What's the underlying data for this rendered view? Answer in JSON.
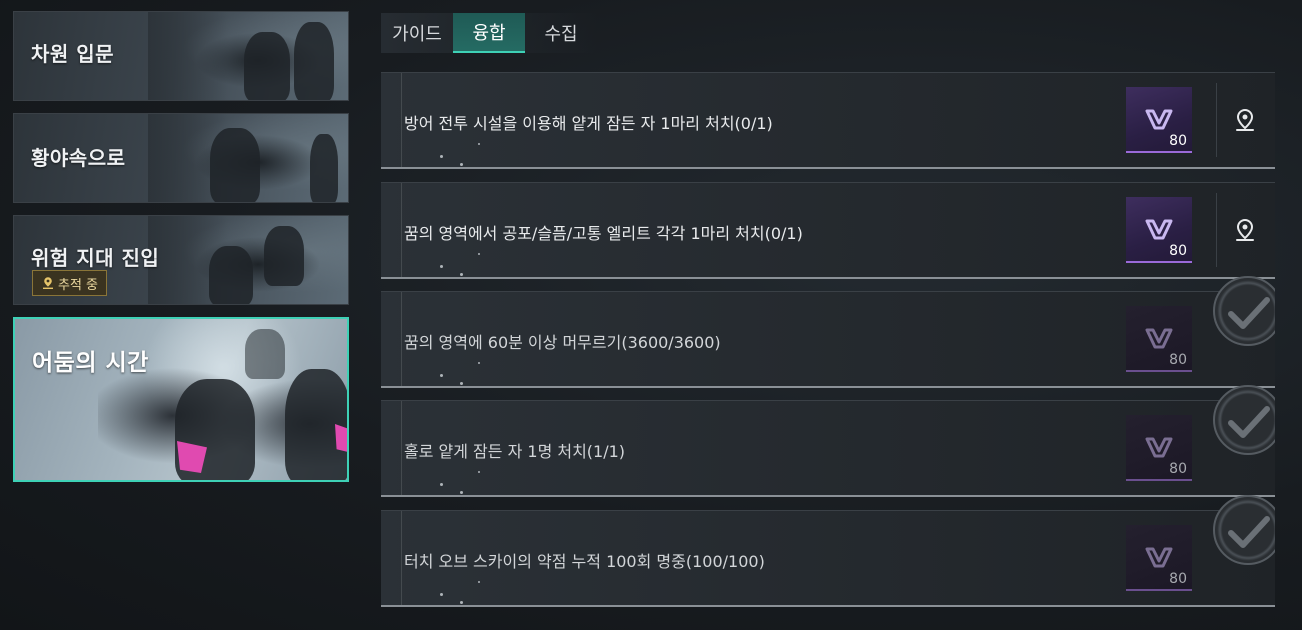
{
  "chapters": [
    {
      "title": "차원 입문"
    },
    {
      "title": "황야속으로"
    },
    {
      "title": "위험 지대 진입",
      "badge": "추적 중"
    },
    {
      "title": "어둠의 시간",
      "selected": true
    }
  ],
  "tabs": [
    {
      "label": "가이드"
    },
    {
      "label": "융합",
      "active": true
    },
    {
      "label": "수집"
    }
  ],
  "missions": [
    {
      "text": "방어 전투 시설을 이용해 얕게 잠든 자 1마리 처치(0/1)",
      "reward_qty": "80",
      "completed": false
    },
    {
      "text": "꿈의 영역에서 공포/슬픔/고통 엘리트 각각 1마리 처치(0/1)",
      "reward_qty": "80",
      "completed": false
    },
    {
      "text": "꿈의 영역에 60분 이상 머무르기(3600/3600)",
      "reward_qty": "80",
      "completed": true
    },
    {
      "text": "홀로 얕게 잠든 자 1명 처치(1/1)",
      "reward_qty": "80",
      "completed": true
    },
    {
      "text": "터치 오브 스카이의 약점 누적 100회 명중(100/100)",
      "reward_qty": "80",
      "completed": true
    }
  ],
  "icons": {
    "reward": "reward-crystal-icon",
    "locate": "map-pin-icon",
    "completed": "checkmark-icon",
    "tracking": "pin-icon"
  },
  "colors": {
    "accent": "#3ed1b6",
    "reward_purple": "#9a6ad8",
    "tracking_gold": "#ecd9a0"
  }
}
